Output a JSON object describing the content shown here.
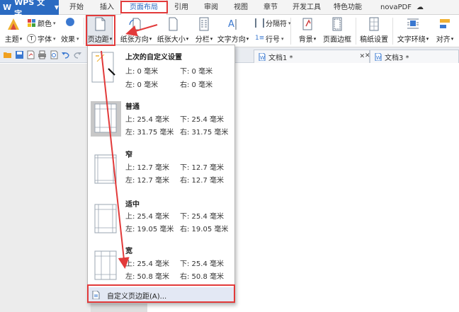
{
  "app": {
    "name": "WPS 文字"
  },
  "menu_tabs": [
    {
      "label": "开始"
    },
    {
      "label": "插入"
    },
    {
      "label": "页面布局"
    },
    {
      "label": "引用"
    },
    {
      "label": "审阅"
    },
    {
      "label": "视图"
    },
    {
      "label": "章节"
    },
    {
      "label": "开发工具"
    },
    {
      "label": "特色功能"
    },
    {
      "label": "novaPDF"
    }
  ],
  "ribbon": {
    "theme": "主题",
    "color": "颜色",
    "font": "字体",
    "effect": "效果",
    "margins": "页边距",
    "orientation": "纸张方向",
    "size": "纸张大小",
    "columns": "分栏",
    "text_direction": "文字方向",
    "separator": "分隔符",
    "line_numbers": "行号",
    "background": "背景",
    "page_border": "页面边框",
    "paper_setup": "稿纸设置",
    "text_wrap": "文字环绕",
    "align": "对齐"
  },
  "doc_tabs": [
    {
      "label": "文档1 *"
    },
    {
      "label": "文档3 *"
    }
  ],
  "margins_menu": {
    "presets": [
      {
        "name": "上次的自定义设置",
        "top": "上: 0 毫米",
        "bottom": "下: 0 毫米",
        "left": "左: 0 毫米",
        "right": "右: 0 毫米"
      },
      {
        "name": "普通",
        "top": "上: 25.4 毫米",
        "bottom": "下: 25.4 毫米",
        "left": "左: 31.75 毫米",
        "right": "右: 31.75 毫米"
      },
      {
        "name": "窄",
        "top": "上: 12.7 毫米",
        "bottom": "下: 12.7 毫米",
        "left": "左: 12.7 毫米",
        "right": "右: 12.7 毫米"
      },
      {
        "name": "适中",
        "top": "上: 25.4 毫米",
        "bottom": "下: 25.4 毫米",
        "left": "左: 19.05 毫米",
        "right": "右: 19.05 毫米"
      },
      {
        "name": "宽",
        "top": "上: 25.4 毫米",
        "bottom": "下: 25.4 毫米",
        "left": "左: 50.8 毫米",
        "right": "右: 50.8 毫米"
      }
    ],
    "custom": "自定义页边距(A)..."
  },
  "colors": {
    "accent": "#2b6bc2",
    "annotation": "#e23a3a",
    "selected_preset": "#c8c8c8"
  }
}
